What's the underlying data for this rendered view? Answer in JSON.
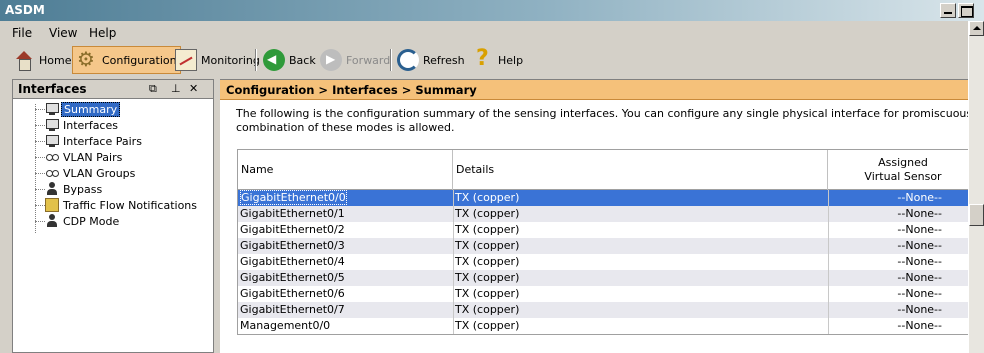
{
  "window": {
    "title": "ASDM"
  },
  "menubar": {
    "items": [
      "File",
      "View",
      "Help"
    ]
  },
  "toolbar": {
    "home": "Home",
    "configuration": "Configuration",
    "monitoring": "Monitoring",
    "back": "Back",
    "forward": "Forward",
    "refresh": "Refresh",
    "help": "Help"
  },
  "sidebar": {
    "title": "Interfaces",
    "items": [
      {
        "label": "Summary",
        "icon": "monitor-icon"
      },
      {
        "label": "Interfaces",
        "icon": "monitor-person-icon"
      },
      {
        "label": "Interface Pairs",
        "icon": "monitor-pair-icon"
      },
      {
        "label": "VLAN Pairs",
        "icon": "link-icon"
      },
      {
        "label": "VLAN Groups",
        "icon": "link-icon"
      },
      {
        "label": "Bypass",
        "icon": "person-icon"
      },
      {
        "label": "Traffic Flow Notifications",
        "icon": "flow-icon"
      },
      {
        "label": "CDP Mode",
        "icon": "person-icon"
      }
    ]
  },
  "main": {
    "breadcrumb": "Configuration > Interfaces > Summary",
    "description_line1": "The following is the configuration summary of the sensing interfaces. You can configure any single physical interface for promiscuous, inline interface pai",
    "description_line2": "combination of these modes is allowed.",
    "table": {
      "headers": {
        "name": "Name",
        "details": "Details",
        "vs_line1": "Assigned",
        "vs_line2": "Virtual Sensor"
      },
      "rows": [
        {
          "name": "GigabitEthernet0/0",
          "details": "TX (copper)",
          "vs": "--None--"
        },
        {
          "name": "GigabitEthernet0/1",
          "details": "TX (copper)",
          "vs": "--None--"
        },
        {
          "name": "GigabitEthernet0/2",
          "details": "TX (copper)",
          "vs": "--None--"
        },
        {
          "name": "GigabitEthernet0/3",
          "details": "TX (copper)",
          "vs": "--None--"
        },
        {
          "name": "GigabitEthernet0/4",
          "details": "TX (copper)",
          "vs": "--None--"
        },
        {
          "name": "GigabitEthernet0/5",
          "details": "TX (copper)",
          "vs": "--None--"
        },
        {
          "name": "GigabitEthernet0/6",
          "details": "TX (copper)",
          "vs": "--None--"
        },
        {
          "name": "GigabitEthernet0/7",
          "details": "TX (copper)",
          "vs": "--None--"
        },
        {
          "name": "Management0/0",
          "details": "TX (copper)",
          "vs": "--None--"
        }
      ]
    }
  },
  "colors": {
    "accent_header": "#f5c17a",
    "selection": "#3a73d6",
    "title_gradient_start": "#4e7d95"
  }
}
